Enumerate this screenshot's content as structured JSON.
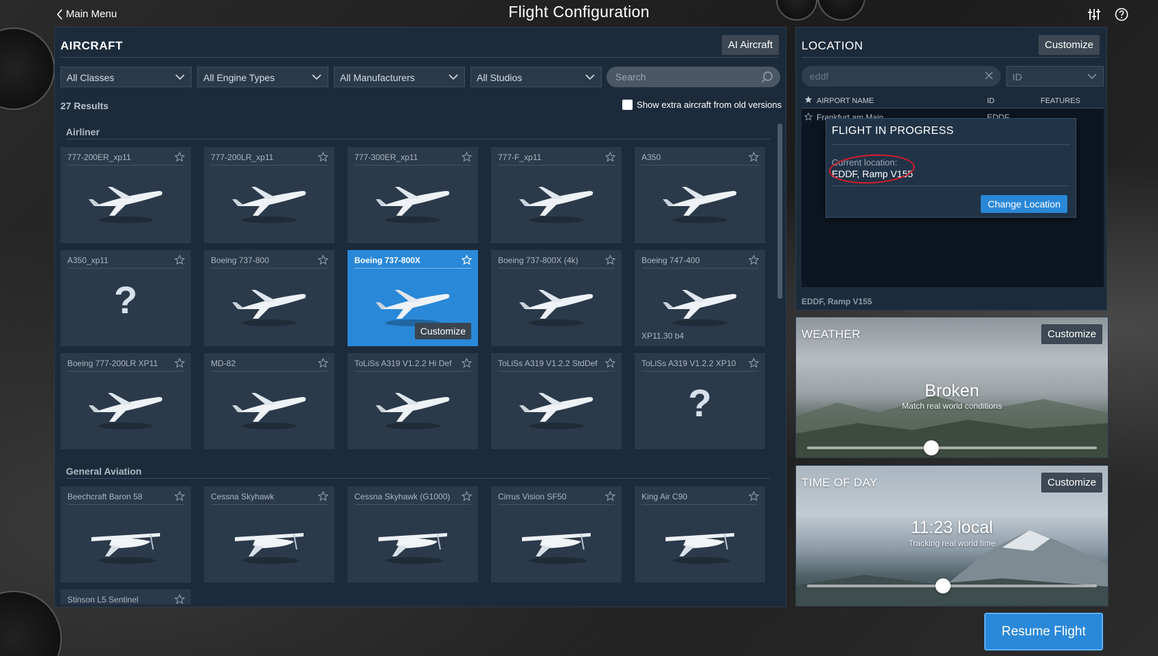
{
  "topbar": {
    "back_label": "Main Menu",
    "title": "Flight Configuration"
  },
  "aircraft": {
    "title": "AIRCRAFT",
    "ai_button": "AI Aircraft",
    "filters": {
      "classes": "All Classes",
      "engines": "All Engine Types",
      "manufacturers": "All Manufacturers",
      "studios": "All Studios",
      "search_placeholder": "Search"
    },
    "results": "27 Results",
    "old_versions_label": "Show extra aircraft from old versions",
    "sections": {
      "airliner": "Airliner",
      "general": "General Aviation"
    },
    "cards": [
      {
        "name": "777-200ER_xp11",
        "icon": "plane"
      },
      {
        "name": "777-200LR_xp11",
        "icon": "plane"
      },
      {
        "name": "777-300ER_xp11",
        "icon": "plane"
      },
      {
        "name": "777-F_xp11",
        "icon": "plane"
      },
      {
        "name": "A350",
        "icon": "plane"
      },
      {
        "name": "A350_xp11",
        "icon": "unknown"
      },
      {
        "name": "Boeing 737-800",
        "icon": "plane"
      },
      {
        "name": "Boeing 737-800X",
        "icon": "plane",
        "customize": "Customize"
      },
      {
        "name": "Boeing 737-800X (4k)",
        "icon": "plane"
      },
      {
        "name": "Boeing 747-400",
        "icon": "plane",
        "version": "XP11.30 b4"
      },
      {
        "name": "Boeing 777-200LR XP11",
        "icon": "plane"
      },
      {
        "name": "MD-82",
        "icon": "plane"
      },
      {
        "name": "ToLiSs A319 V1.2.2 Hi Def",
        "icon": "plane"
      },
      {
        "name": "ToLiSs A319 V1.2.2 StdDef",
        "icon": "plane"
      },
      {
        "name": "ToLiSs A319 V1.2.2 XP10",
        "icon": "unknown"
      },
      {
        "name": "Beechcraft Baron 58",
        "icon": "prop"
      },
      {
        "name": "Cessna Skyhawk",
        "icon": "prop"
      },
      {
        "name": "Cessna Skyhawk (G1000)",
        "icon": "prop"
      },
      {
        "name": "Cirrus Vision SF50",
        "icon": "prop"
      },
      {
        "name": "King Air C90",
        "icon": "prop"
      },
      {
        "name": "Stinson L5 Sentinel",
        "icon": "prop"
      }
    ]
  },
  "location": {
    "title": "LOCATION",
    "customize": "Customize",
    "search_value": "eddf",
    "id_select": "ID",
    "columns": {
      "name": "AIRPORT NAME",
      "id": "ID",
      "features": "FEATURES"
    },
    "rows": [
      {
        "name": "Frankfurt am Main",
        "id": "EDDF"
      }
    ],
    "footer": "EDDF, Ramp V155"
  },
  "modal": {
    "title": "FLIGHT IN PROGRESS",
    "sub": "Current location:",
    "location": "EDDF, Ramp V155",
    "button": "Change Location"
  },
  "weather": {
    "title": "WEATHER",
    "customize": "Customize",
    "condition": "Broken",
    "sub": "Match real world conditions",
    "slider_fraction": 0.43
  },
  "time_of_day": {
    "title": "TIME OF DAY",
    "customize": "Customize",
    "time": "11:23 local",
    "sub": "Tracking real world time",
    "slider_fraction": 0.47
  },
  "resume": "Resume Flight",
  "colors": {
    "accent": "#2a88d8",
    "panel": "#1c2b3b",
    "card": "#2b3a4b",
    "annotation": "#d61c2a"
  }
}
